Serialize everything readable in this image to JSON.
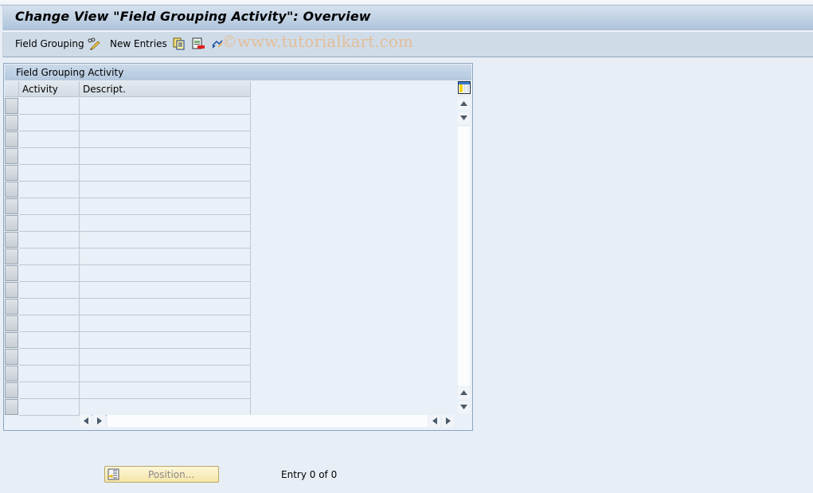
{
  "window": {
    "title": "Change View \"Field Grouping Activity\": Overview"
  },
  "toolbar": {
    "items": [
      {
        "label": "Field Grouping",
        "type": "text-button"
      },
      {
        "icon": "pencil-glasses-icon",
        "type": "icon-button"
      },
      {
        "label": "New Entries",
        "type": "text-button"
      },
      {
        "icon": "copy-icon",
        "type": "icon-button"
      },
      {
        "icon": "delete-icon",
        "type": "icon-button"
      },
      {
        "icon": "undo-icon",
        "type": "icon-button"
      }
    ],
    "watermark": "©www.tutorialkart.com"
  },
  "table": {
    "title": "Field Grouping Activity",
    "columns": [
      "Activity",
      "Descript."
    ],
    "row_count": 19,
    "rows": []
  },
  "footer": {
    "position_button": "Position...",
    "entry_status": "Entry 0 of 0"
  },
  "colors": {
    "title_gradient_top": "#d6e2ef",
    "title_gradient_bottom": "#adc3da",
    "toolbar_bg": "#cfdce8",
    "page_bg": "#e8eef6",
    "panel_border": "#8aa6c4",
    "position_button_bg": "#f5e6a8"
  }
}
